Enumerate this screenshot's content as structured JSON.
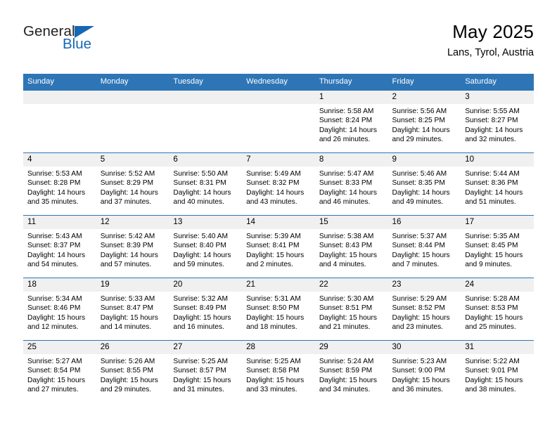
{
  "brand": {
    "name_top": "General",
    "name_bottom": "Blue",
    "accent_color": "#1568b4"
  },
  "header": {
    "title": "May 2025",
    "subtitle": "Lans, Tyrol, Austria",
    "header_bg": "#2e75b6",
    "daynum_bg": "#f0f0f0"
  },
  "weekdays": [
    "Sunday",
    "Monday",
    "Tuesday",
    "Wednesday",
    "Thursday",
    "Friday",
    "Saturday"
  ],
  "weeks": [
    [
      {
        "day": "",
        "sunrise": "",
        "sunset": "",
        "daylight1": "",
        "daylight2": ""
      },
      {
        "day": "",
        "sunrise": "",
        "sunset": "",
        "daylight1": "",
        "daylight2": ""
      },
      {
        "day": "",
        "sunrise": "",
        "sunset": "",
        "daylight1": "",
        "daylight2": ""
      },
      {
        "day": "",
        "sunrise": "",
        "sunset": "",
        "daylight1": "",
        "daylight2": ""
      },
      {
        "day": "1",
        "sunrise": "Sunrise: 5:58 AM",
        "sunset": "Sunset: 8:24 PM",
        "daylight1": "Daylight: 14 hours",
        "daylight2": "and 26 minutes."
      },
      {
        "day": "2",
        "sunrise": "Sunrise: 5:56 AM",
        "sunset": "Sunset: 8:25 PM",
        "daylight1": "Daylight: 14 hours",
        "daylight2": "and 29 minutes."
      },
      {
        "day": "3",
        "sunrise": "Sunrise: 5:55 AM",
        "sunset": "Sunset: 8:27 PM",
        "daylight1": "Daylight: 14 hours",
        "daylight2": "and 32 minutes."
      }
    ],
    [
      {
        "day": "4",
        "sunrise": "Sunrise: 5:53 AM",
        "sunset": "Sunset: 8:28 PM",
        "daylight1": "Daylight: 14 hours",
        "daylight2": "and 35 minutes."
      },
      {
        "day": "5",
        "sunrise": "Sunrise: 5:52 AM",
        "sunset": "Sunset: 8:29 PM",
        "daylight1": "Daylight: 14 hours",
        "daylight2": "and 37 minutes."
      },
      {
        "day": "6",
        "sunrise": "Sunrise: 5:50 AM",
        "sunset": "Sunset: 8:31 PM",
        "daylight1": "Daylight: 14 hours",
        "daylight2": "and 40 minutes."
      },
      {
        "day": "7",
        "sunrise": "Sunrise: 5:49 AM",
        "sunset": "Sunset: 8:32 PM",
        "daylight1": "Daylight: 14 hours",
        "daylight2": "and 43 minutes."
      },
      {
        "day": "8",
        "sunrise": "Sunrise: 5:47 AM",
        "sunset": "Sunset: 8:33 PM",
        "daylight1": "Daylight: 14 hours",
        "daylight2": "and 46 minutes."
      },
      {
        "day": "9",
        "sunrise": "Sunrise: 5:46 AM",
        "sunset": "Sunset: 8:35 PM",
        "daylight1": "Daylight: 14 hours",
        "daylight2": "and 49 minutes."
      },
      {
        "day": "10",
        "sunrise": "Sunrise: 5:44 AM",
        "sunset": "Sunset: 8:36 PM",
        "daylight1": "Daylight: 14 hours",
        "daylight2": "and 51 minutes."
      }
    ],
    [
      {
        "day": "11",
        "sunrise": "Sunrise: 5:43 AM",
        "sunset": "Sunset: 8:37 PM",
        "daylight1": "Daylight: 14 hours",
        "daylight2": "and 54 minutes."
      },
      {
        "day": "12",
        "sunrise": "Sunrise: 5:42 AM",
        "sunset": "Sunset: 8:39 PM",
        "daylight1": "Daylight: 14 hours",
        "daylight2": "and 57 minutes."
      },
      {
        "day": "13",
        "sunrise": "Sunrise: 5:40 AM",
        "sunset": "Sunset: 8:40 PM",
        "daylight1": "Daylight: 14 hours",
        "daylight2": "and 59 minutes."
      },
      {
        "day": "14",
        "sunrise": "Sunrise: 5:39 AM",
        "sunset": "Sunset: 8:41 PM",
        "daylight1": "Daylight: 15 hours",
        "daylight2": "and 2 minutes."
      },
      {
        "day": "15",
        "sunrise": "Sunrise: 5:38 AM",
        "sunset": "Sunset: 8:43 PM",
        "daylight1": "Daylight: 15 hours",
        "daylight2": "and 4 minutes."
      },
      {
        "day": "16",
        "sunrise": "Sunrise: 5:37 AM",
        "sunset": "Sunset: 8:44 PM",
        "daylight1": "Daylight: 15 hours",
        "daylight2": "and 7 minutes."
      },
      {
        "day": "17",
        "sunrise": "Sunrise: 5:35 AM",
        "sunset": "Sunset: 8:45 PM",
        "daylight1": "Daylight: 15 hours",
        "daylight2": "and 9 minutes."
      }
    ],
    [
      {
        "day": "18",
        "sunrise": "Sunrise: 5:34 AM",
        "sunset": "Sunset: 8:46 PM",
        "daylight1": "Daylight: 15 hours",
        "daylight2": "and 12 minutes."
      },
      {
        "day": "19",
        "sunrise": "Sunrise: 5:33 AM",
        "sunset": "Sunset: 8:47 PM",
        "daylight1": "Daylight: 15 hours",
        "daylight2": "and 14 minutes."
      },
      {
        "day": "20",
        "sunrise": "Sunrise: 5:32 AM",
        "sunset": "Sunset: 8:49 PM",
        "daylight1": "Daylight: 15 hours",
        "daylight2": "and 16 minutes."
      },
      {
        "day": "21",
        "sunrise": "Sunrise: 5:31 AM",
        "sunset": "Sunset: 8:50 PM",
        "daylight1": "Daylight: 15 hours",
        "daylight2": "and 18 minutes."
      },
      {
        "day": "22",
        "sunrise": "Sunrise: 5:30 AM",
        "sunset": "Sunset: 8:51 PM",
        "daylight1": "Daylight: 15 hours",
        "daylight2": "and 21 minutes."
      },
      {
        "day": "23",
        "sunrise": "Sunrise: 5:29 AM",
        "sunset": "Sunset: 8:52 PM",
        "daylight1": "Daylight: 15 hours",
        "daylight2": "and 23 minutes."
      },
      {
        "day": "24",
        "sunrise": "Sunrise: 5:28 AM",
        "sunset": "Sunset: 8:53 PM",
        "daylight1": "Daylight: 15 hours",
        "daylight2": "and 25 minutes."
      }
    ],
    [
      {
        "day": "25",
        "sunrise": "Sunrise: 5:27 AM",
        "sunset": "Sunset: 8:54 PM",
        "daylight1": "Daylight: 15 hours",
        "daylight2": "and 27 minutes."
      },
      {
        "day": "26",
        "sunrise": "Sunrise: 5:26 AM",
        "sunset": "Sunset: 8:55 PM",
        "daylight1": "Daylight: 15 hours",
        "daylight2": "and 29 minutes."
      },
      {
        "day": "27",
        "sunrise": "Sunrise: 5:25 AM",
        "sunset": "Sunset: 8:57 PM",
        "daylight1": "Daylight: 15 hours",
        "daylight2": "and 31 minutes."
      },
      {
        "day": "28",
        "sunrise": "Sunrise: 5:25 AM",
        "sunset": "Sunset: 8:58 PM",
        "daylight1": "Daylight: 15 hours",
        "daylight2": "and 33 minutes."
      },
      {
        "day": "29",
        "sunrise": "Sunrise: 5:24 AM",
        "sunset": "Sunset: 8:59 PM",
        "daylight1": "Daylight: 15 hours",
        "daylight2": "and 34 minutes."
      },
      {
        "day": "30",
        "sunrise": "Sunrise: 5:23 AM",
        "sunset": "Sunset: 9:00 PM",
        "daylight1": "Daylight: 15 hours",
        "daylight2": "and 36 minutes."
      },
      {
        "day": "31",
        "sunrise": "Sunrise: 5:22 AM",
        "sunset": "Sunset: 9:01 PM",
        "daylight1": "Daylight: 15 hours",
        "daylight2": "and 38 minutes."
      }
    ]
  ]
}
